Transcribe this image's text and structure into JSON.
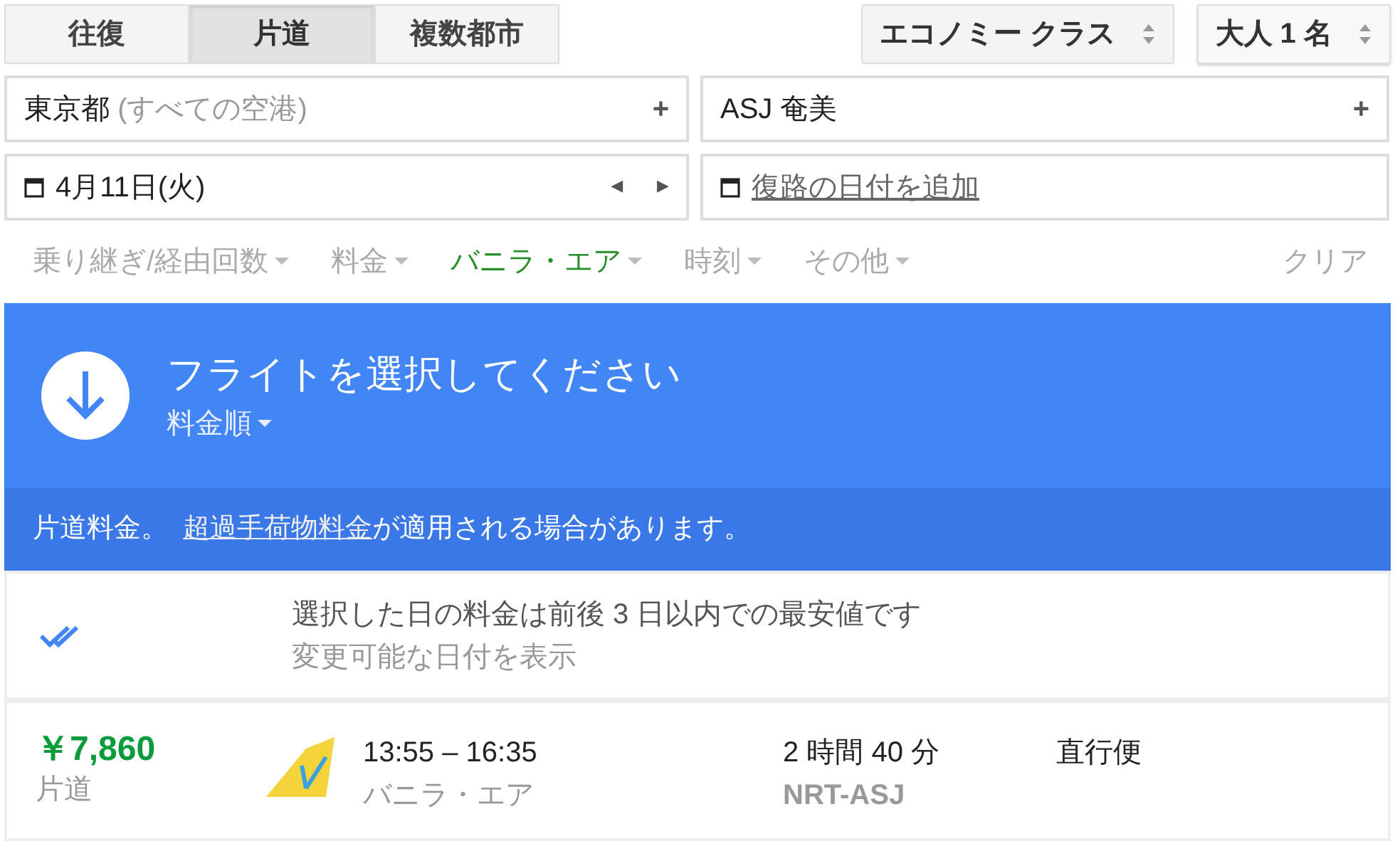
{
  "trip_tabs": [
    {
      "label": "往復",
      "selected": false
    },
    {
      "label": "片道",
      "selected": true
    },
    {
      "label": "複数都市",
      "selected": false
    }
  ],
  "cabin_select": {
    "value": "エコノミー クラス"
  },
  "passengers_select": {
    "value": "大人 1 名"
  },
  "origin": {
    "value": "東京都",
    "hint": "(すべての空港)",
    "add": "+"
  },
  "destination": {
    "value": "ASJ 奄美",
    "add": "+"
  },
  "depart_date": {
    "value": "4月11日(火)",
    "prev": "◀",
    "next": "▶"
  },
  "return_date": {
    "link": "復路の日付を追加"
  },
  "filters": [
    {
      "label": "乗り継ぎ/経由回数",
      "active": false
    },
    {
      "label": "料金",
      "active": false
    },
    {
      "label": "バニラ・エア",
      "active": true
    },
    {
      "label": "時刻",
      "active": false
    },
    {
      "label": "その他",
      "active": false
    }
  ],
  "clear": "クリア",
  "header": {
    "title": "フライトを選択してください",
    "sort": "料金順"
  },
  "notice": {
    "text": "片道料金。",
    "link": "超過手荷物料金",
    "rest": "が適用される場合があります。"
  },
  "tip": {
    "line1": "選択した日の料金は前後 3 日以内での最安値です",
    "line2": "変更可能な日付を表示"
  },
  "flights": [
    {
      "price": "￥7,860",
      "fare_type": "片道",
      "times": "13:55 – 16:35",
      "airline": "バニラ・エア",
      "duration": "2 時間 40 分",
      "route": "NRT-ASJ",
      "stops": "直行便"
    }
  ]
}
